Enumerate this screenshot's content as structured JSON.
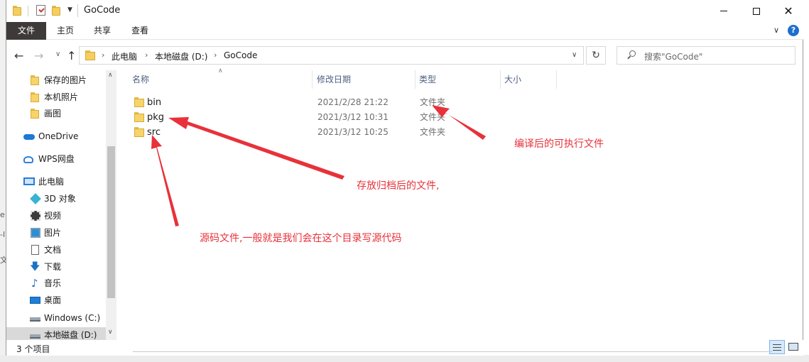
{
  "window": {
    "title": "GoCode"
  },
  "ribbon": {
    "tabs": [
      {
        "label": "文件",
        "active": true
      },
      {
        "label": "主页",
        "active": false
      },
      {
        "label": "共享",
        "active": false
      },
      {
        "label": "查看",
        "active": false
      }
    ],
    "help_label": "?"
  },
  "address": {
    "breadcrumb": [
      "此电脑",
      "本地磁盘 (D:)",
      "GoCode"
    ],
    "search_placeholder": "搜索\"GoCode\""
  },
  "sidebar": {
    "items": [
      {
        "label": "保存的图片",
        "icon": "folder-icon"
      },
      {
        "label": "本机照片",
        "icon": "folder-icon"
      },
      {
        "label": "画图",
        "icon": "folder-icon"
      },
      {
        "label": "OneDrive",
        "icon": "cloud-icon"
      },
      {
        "label": "WPS网盘",
        "icon": "wps-cloud-icon"
      },
      {
        "label": "此电脑",
        "icon": "computer-icon"
      },
      {
        "label": "3D 对象",
        "icon": "cube-3d-icon"
      },
      {
        "label": "视频",
        "icon": "video-icon"
      },
      {
        "label": "图片",
        "icon": "picture-icon"
      },
      {
        "label": "文档",
        "icon": "document-icon"
      },
      {
        "label": "下载",
        "icon": "download-icon"
      },
      {
        "label": "音乐",
        "icon": "music-icon"
      },
      {
        "label": "桌面",
        "icon": "desktop-icon"
      },
      {
        "label": "Windows (C:)",
        "icon": "drive-icon"
      },
      {
        "label": "本地磁盘 (D:)",
        "icon": "drive-icon",
        "selected": true
      }
    ]
  },
  "columns": {
    "name": "名称",
    "modified": "修改日期",
    "type": "类型",
    "size": "大小"
  },
  "files": [
    {
      "name": "bin",
      "modified": "2021/2/28 21:22",
      "type": "文件夹",
      "size": ""
    },
    {
      "name": "pkg",
      "modified": "2021/3/12 10:31",
      "type": "文件夹",
      "size": ""
    },
    {
      "name": "src",
      "modified": "2021/3/12 10:25",
      "type": "文件夹",
      "size": ""
    }
  ],
  "annotations": {
    "bin": "编译后的可执行文件",
    "pkg": "存放归档后的文件,",
    "src": "源码文件,一般就是我们会在这个目录写源代码",
    "color": "#e8313a"
  },
  "status": {
    "item_count": "3 个项目"
  },
  "colors": {
    "active_tab_bg": "#3f3a3a",
    "folder": "#f6d46a",
    "header_text": "#4d6082",
    "accent": "#1d6fce"
  }
}
